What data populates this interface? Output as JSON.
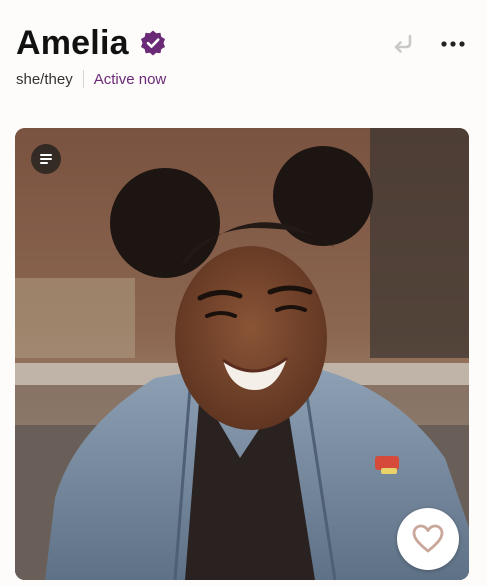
{
  "profile": {
    "name": "Amelia",
    "pronouns": "she/they",
    "status": "Active now",
    "verified": true
  },
  "icons": {
    "verified": "verified-badge-icon",
    "undo": "undo-arrow-icon",
    "more": "more-dots-icon",
    "prompt": "text-lines-icon",
    "like": "heart-icon"
  },
  "colors": {
    "accent": "#6b2a77",
    "background": "#fdfcfa",
    "like_heart": "#c9a79b"
  }
}
